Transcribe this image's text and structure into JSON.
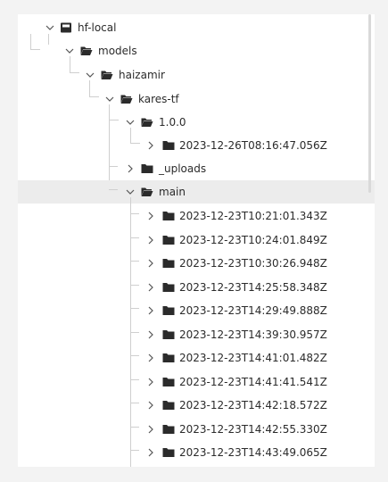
{
  "tree": {
    "root": {
      "label": "hf-local",
      "icon": "drive-icon"
    },
    "models": {
      "label": "models"
    },
    "haizamir": {
      "label": "haizamir"
    },
    "kares": {
      "label": "kares-tf"
    },
    "v100": {
      "label": "1.0.0"
    },
    "v100_child": {
      "label": "2023-12-26T08:16:47.056Z"
    },
    "uploads": {
      "label": "_uploads"
    },
    "main": {
      "label": "main"
    },
    "main_children": [
      "2023-12-23T10:21:01.343Z",
      "2023-12-23T10:24:01.849Z",
      "2023-12-23T10:30:26.948Z",
      "2023-12-23T14:25:58.348Z",
      "2023-12-23T14:29:49.888Z",
      "2023-12-23T14:39:30.957Z",
      "2023-12-23T14:41:01.482Z",
      "2023-12-23T14:41:41.541Z",
      "2023-12-23T14:42:18.572Z",
      "2023-12-23T14:42:55.330Z",
      "2023-12-23T14:43:49.065Z"
    ]
  },
  "colors": {
    "folder": "#2b2b2b",
    "selected_row": "#ececec",
    "guide": "#cfcfcf"
  }
}
